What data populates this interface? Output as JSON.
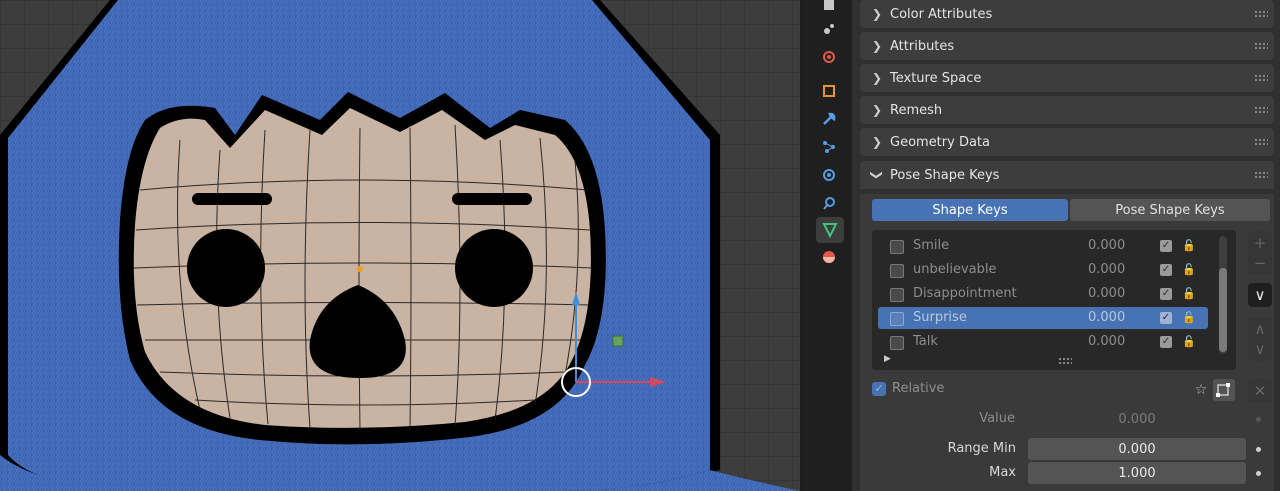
{
  "panels": [
    {
      "label": "Color Attributes",
      "expanded": false
    },
    {
      "label": "Attributes",
      "expanded": false
    },
    {
      "label": "Texture Space",
      "expanded": false
    },
    {
      "label": "Remesh",
      "expanded": false
    },
    {
      "label": "Geometry Data",
      "expanded": false
    },
    {
      "label": "Pose Shape Keys",
      "expanded": true
    }
  ],
  "pose_shape_keys": {
    "tabs": [
      "Shape Keys",
      "Pose Shape Keys"
    ],
    "active_tab": "Shape Keys",
    "keys": [
      {
        "name": "Smile",
        "value": "0.000",
        "selected": false
      },
      {
        "name": "unbelievable",
        "value": "0.000",
        "selected": false
      },
      {
        "name": "Disappointment",
        "value": "0.000",
        "selected": false
      },
      {
        "name": "Surprise",
        "value": "0.000",
        "selected": true
      },
      {
        "name": "Talk",
        "value": "0.000",
        "selected": false
      }
    ],
    "relative_label": "Relative",
    "value_label": "Value",
    "value": "0.000",
    "range_min_label": "Range Min",
    "range_min": "0.000",
    "max_label": "Max",
    "max": "1.000"
  },
  "icons": {
    "tabs": [
      "texture-paint-icon",
      "particles-icon",
      "physics-icon",
      "object-icon",
      "modifier-icon",
      "particles-system-icon",
      "physics-field-icon",
      "constraints-icon",
      "object-data-icon",
      "material-icon"
    ],
    "list_side": [
      "add-icon",
      "remove-icon",
      "dropdown-menu-icon",
      "move-up-icon",
      "move-down-icon"
    ]
  },
  "colors": {
    "accent": "#4772b3",
    "hood": "#3f67b5",
    "face": "#c9b3a3"
  }
}
